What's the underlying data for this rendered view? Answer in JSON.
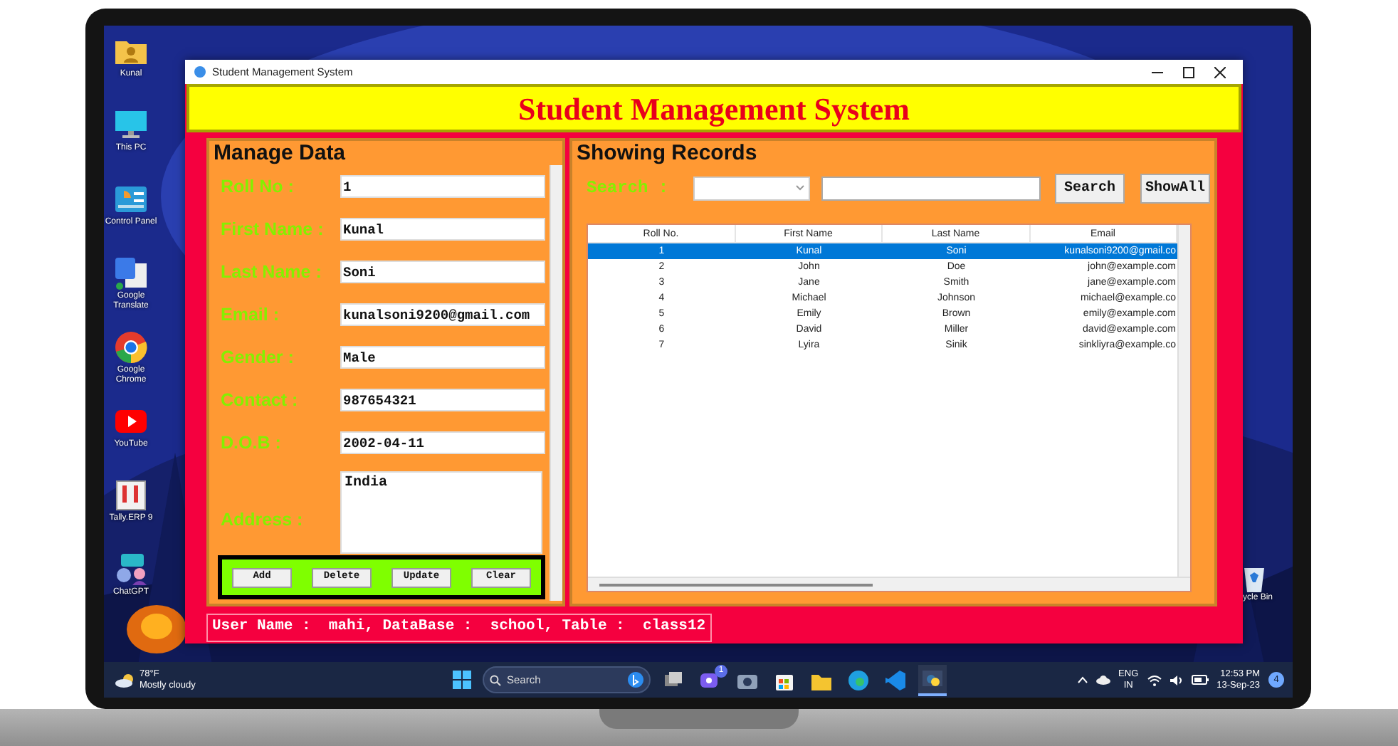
{
  "desktop": {
    "shortcuts": [
      {
        "label": "Kunal"
      },
      {
        "label": "This PC"
      },
      {
        "label": "Control Panel"
      },
      {
        "label": "Google Translate"
      },
      {
        "label": "Google Chrome"
      },
      {
        "label": "YouTube"
      },
      {
        "label": "Tally.ERP 9"
      },
      {
        "label": "ChatGPT"
      }
    ],
    "recycle_bin": {
      "label": "ycle Bin"
    }
  },
  "window": {
    "title": "Student Management System"
  },
  "header": "Student Management System",
  "manage_data": {
    "title": "Manage Data",
    "fields": [
      {
        "label": "Roll No :",
        "value": "1",
        "kind": "entry"
      },
      {
        "label": "First Name :",
        "value": "Kunal",
        "kind": "entry"
      },
      {
        "label": "Last Name :",
        "value": "Soni",
        "kind": "entry"
      },
      {
        "label": "Email :",
        "value": "kunalsoni9200@gmail.com",
        "kind": "entry"
      },
      {
        "label": "Gender  :",
        "value": "Male",
        "kind": "entry"
      },
      {
        "label": "Contact :",
        "value": "987654321",
        "kind": "entry"
      },
      {
        "label": "D.O.B :",
        "value": "2002-04-11",
        "kind": "entry"
      },
      {
        "label": "Address :",
        "value": "India",
        "kind": "text"
      }
    ],
    "buttons": [
      "Add",
      "Delete",
      "Update",
      "Clear"
    ]
  },
  "records": {
    "title": "Showing Records",
    "search_label": "Search :",
    "buttons": [
      "Search",
      "ShowAll"
    ],
    "table": {
      "columns": [
        "Roll No.",
        "First Name",
        "Last Name",
        "Email"
      ],
      "rows": [
        {
          "cells": [
            "1",
            "Kunal",
            "Soni",
            "kunalsoni9200@gmail.co"
          ],
          "selected": true
        },
        {
          "cells": [
            "2",
            "John",
            "Doe",
            "john@example.com"
          ],
          "selected": false
        },
        {
          "cells": [
            "3",
            "Jane",
            "Smith",
            "jane@example.com"
          ],
          "selected": false
        },
        {
          "cells": [
            "4",
            "Michael",
            "Johnson",
            "michael@example.co"
          ],
          "selected": false
        },
        {
          "cells": [
            "5",
            "Emily",
            "Brown",
            "emily@example.com"
          ],
          "selected": false
        },
        {
          "cells": [
            "6",
            "David",
            "Miller",
            "david@example.com"
          ],
          "selected": false
        },
        {
          "cells": [
            "7",
            "Lyira",
            "Sinik",
            "sinkliyra@example.co"
          ],
          "selected": false
        }
      ]
    }
  },
  "status": "User Name :  mahi, DataBase :  school, Table :  class12",
  "taskbar": {
    "weather": {
      "temperature": "78°F",
      "condition": "Mostly cloudy"
    },
    "search_placeholder": "Search",
    "chat_badge": "1",
    "language": [
      "ENG",
      "IN"
    ],
    "time": "12:53 PM",
    "date": "13-Sep-23",
    "notifications": "4"
  }
}
